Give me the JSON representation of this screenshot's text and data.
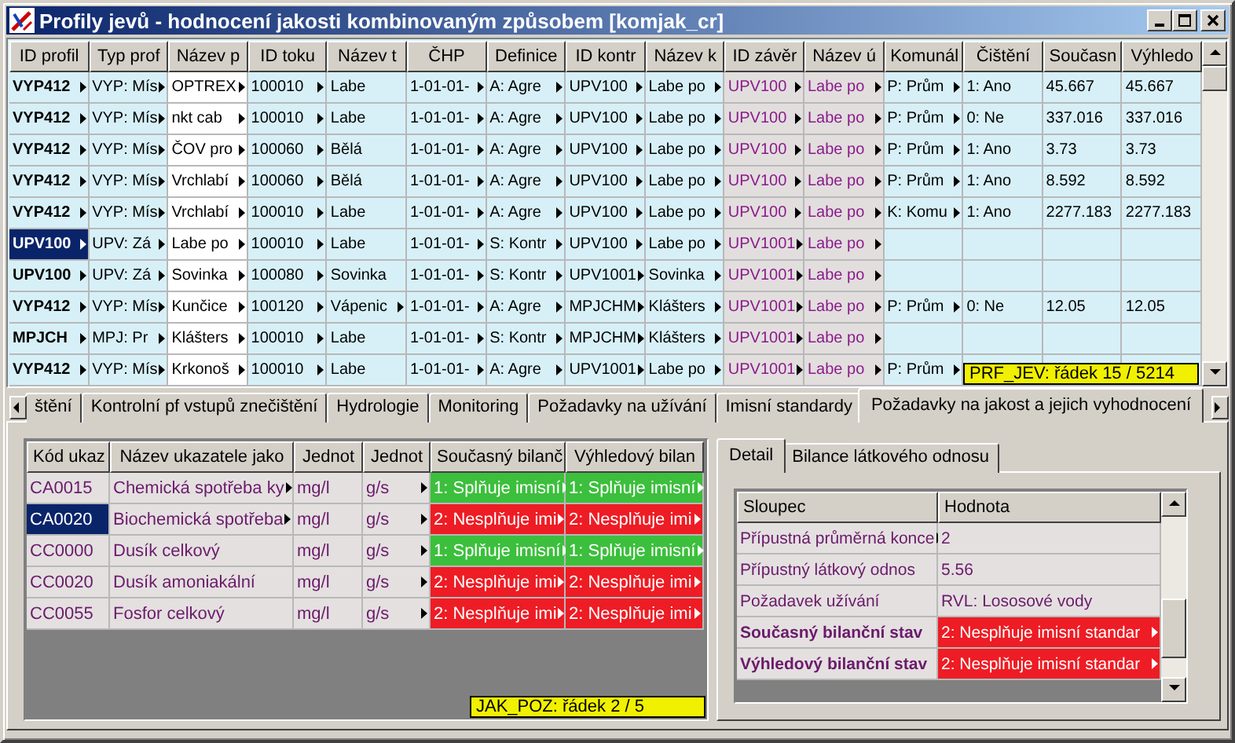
{
  "window": {
    "title": "Profily jevů - hodnocení jakosti kombinovaným způsobem [komjak_cr]"
  },
  "table": {
    "columns": [
      {
        "label": "ID profil",
        "kind": "key"
      },
      {
        "label": "Typ prof",
        "kind": "text"
      },
      {
        "label": "Název p",
        "kind": "edit"
      },
      {
        "label": "ID toku",
        "kind": "text"
      },
      {
        "label": "Název t",
        "kind": "text"
      },
      {
        "label": "ČHP",
        "kind": "text"
      },
      {
        "label": "Definice",
        "kind": "text"
      },
      {
        "label": "ID kontr",
        "kind": "text"
      },
      {
        "label": "Název k",
        "kind": "text"
      },
      {
        "label": "ID závěr",
        "kind": "ref"
      },
      {
        "label": "Název ú",
        "kind": "ref"
      },
      {
        "label": "Komunál",
        "kind": "text"
      },
      {
        "label": "Čištění",
        "kind": "text"
      },
      {
        "label": "Současn",
        "kind": "text"
      },
      {
        "label": "Výhledo",
        "kind": "text"
      }
    ],
    "rows": [
      {
        "selected": false,
        "cells": [
          "VYP412",
          "VYP: Mís",
          "OPTREX",
          "100010",
          "Labe",
          "1-01-01-",
          "A: Agre",
          "UPV100",
          "Labe po",
          "UPV100",
          "Labe po",
          "P: Prům",
          "1: Ano",
          "45.667",
          "45.667"
        ],
        "more": [
          true,
          true,
          true,
          true,
          false,
          true,
          true,
          true,
          true,
          true,
          true,
          true,
          false,
          false,
          false
        ]
      },
      {
        "selected": false,
        "cells": [
          "VYP412",
          "VYP: Mís",
          "nkt cab",
          "100010",
          "Labe",
          "1-01-01-",
          "A: Agre",
          "UPV100",
          "Labe po",
          "UPV100",
          "Labe po",
          "P: Prům",
          "0: Ne",
          "337.016",
          "337.016"
        ],
        "more": [
          true,
          true,
          true,
          true,
          false,
          true,
          true,
          true,
          true,
          true,
          true,
          true,
          false,
          false,
          false
        ]
      },
      {
        "selected": false,
        "cells": [
          "VYP412",
          "VYP: Mís",
          "ČOV pro",
          "100060",
          "Bělá",
          "1-01-01-",
          "A: Agre",
          "UPV100",
          "Labe po",
          "UPV100",
          "Labe po",
          "P: Prům",
          "1: Ano",
          "3.73",
          "3.73"
        ],
        "more": [
          true,
          true,
          true,
          true,
          false,
          true,
          true,
          true,
          true,
          true,
          true,
          true,
          false,
          false,
          false
        ]
      },
      {
        "selected": false,
        "cells": [
          "VYP412",
          "VYP: Mís",
          "Vrchlabí",
          "100060",
          "Bělá",
          "1-01-01-",
          "A: Agre",
          "UPV100",
          "Labe po",
          "UPV100",
          "Labe po",
          "P: Prům",
          "1: Ano",
          "8.592",
          "8.592"
        ],
        "more": [
          true,
          true,
          true,
          true,
          false,
          true,
          true,
          true,
          true,
          true,
          true,
          true,
          false,
          false,
          false
        ]
      },
      {
        "selected": false,
        "cells": [
          "VYP412",
          "VYP: Mís",
          "Vrchlabí",
          "100010",
          "Labe",
          "1-01-01-",
          "A: Agre",
          "UPV100",
          "Labe po",
          "UPV100",
          "Labe po",
          "K: Komu",
          "1: Ano",
          "2277.183",
          "2277.183"
        ],
        "more": [
          true,
          true,
          true,
          true,
          false,
          true,
          true,
          true,
          true,
          true,
          true,
          true,
          false,
          false,
          false
        ]
      },
      {
        "selected": true,
        "cells": [
          "UPV100",
          "UPV: Zá",
          "Labe po",
          "100010",
          "Labe",
          "1-01-01-",
          "S: Kontr",
          "UPV100",
          "Labe po",
          "UPV1001",
          "Labe po"
        ],
        "more": [
          true,
          true,
          true,
          true,
          false,
          true,
          true,
          true,
          true,
          true,
          true
        ]
      },
      {
        "selected": false,
        "cells": [
          "UPV100",
          "UPV: Zá",
          "Sovinka",
          "100080",
          "Sovinka",
          "1-01-01-",
          "S: Kontr",
          "UPV1001",
          "Sovinka",
          "UPV1001",
          "Labe po"
        ],
        "more": [
          true,
          true,
          true,
          true,
          false,
          true,
          true,
          true,
          true,
          true,
          true
        ]
      },
      {
        "selected": false,
        "cells": [
          "VYP412",
          "VYP: Mís",
          "Kunčice",
          "100120",
          "Vápenic",
          "1-01-01-",
          "A: Agre",
          "MPJCHM",
          "Klášters",
          "UPV1001",
          "Labe po",
          "P: Prům",
          "0: Ne",
          "12.05",
          "12.05"
        ],
        "more": [
          true,
          true,
          true,
          true,
          true,
          true,
          true,
          true,
          true,
          true,
          true,
          true,
          false,
          false,
          false
        ]
      },
      {
        "selected": false,
        "cells": [
          "MPJCH",
          "MPJ: Pr",
          "Klášters",
          "100010",
          "Labe",
          "1-01-01-",
          "S: Kontr",
          "MPJCHM",
          "Klášters",
          "UPV1001",
          "Labe po"
        ],
        "more": [
          true,
          true,
          true,
          true,
          false,
          true,
          true,
          true,
          true,
          true,
          true
        ]
      },
      {
        "selected": false,
        "cells": [
          "VYP412",
          "VYP: Mís",
          "Krkonoš",
          "100010",
          "Labe",
          "1-01-01-",
          "A: Agre",
          "UPV1001",
          "Labe po",
          "UPV1001",
          "Labe po",
          "P: Prům"
        ],
        "more": [
          true,
          true,
          true,
          true,
          false,
          true,
          true,
          true,
          true,
          true,
          true,
          true
        ]
      }
    ],
    "status": "PRF_JEV: řádek 15 / 5214"
  },
  "tabs": [
    {
      "label": "štění",
      "selected": false
    },
    {
      "label": "Kontrolní pf vstupů znečištění",
      "selected": false
    },
    {
      "label": "Hydrologie",
      "selected": false
    },
    {
      "label": "Monitoring",
      "selected": false
    },
    {
      "label": "Požadavky na užívání",
      "selected": false
    },
    {
      "label": "Imisní standardy",
      "selected": false
    },
    {
      "label": "Požadavky na jakost a jejich vyhodnocení",
      "selected": true
    }
  ],
  "indicators": {
    "columns": [
      "Kód ukaz",
      "Název ukazatele jako",
      "Jednot",
      "Jednot",
      "Současný bilanč",
      "Výhledový bilan"
    ],
    "rows": [
      {
        "selected": false,
        "cells": [
          {
            "text": "CA0015",
            "more": false
          },
          {
            "text": "Chemická spotřeba ky",
            "more": true
          },
          {
            "text": "mg/l",
            "more": false
          },
          {
            "text": "g/s",
            "more": true
          },
          {
            "text": "1: Splňuje imisní",
            "more": true,
            "color": "#3cbf3c"
          },
          {
            "text": "1: Splňuje imisní",
            "more": true,
            "color": "#3cbf3c"
          }
        ]
      },
      {
        "selected": true,
        "cells": [
          {
            "text": "CA0020",
            "more": false
          },
          {
            "text": "Biochemická spotřeba",
            "more": true
          },
          {
            "text": "mg/l",
            "more": false
          },
          {
            "text": "g/s",
            "more": true
          },
          {
            "text": "2: Nesplňuje imi",
            "more": true,
            "color": "#ee1c24"
          },
          {
            "text": "2: Nesplňuje imi",
            "more": true,
            "color": "#ee1c24"
          }
        ]
      },
      {
        "selected": false,
        "cells": [
          {
            "text": "CC0000",
            "more": false
          },
          {
            "text": "Dusík celkový",
            "more": false
          },
          {
            "text": "mg/l",
            "more": false
          },
          {
            "text": "g/s",
            "more": true
          },
          {
            "text": "1: Splňuje imisní",
            "more": true,
            "color": "#3cbf3c"
          },
          {
            "text": "1: Splňuje imisní",
            "more": true,
            "color": "#3cbf3c"
          }
        ]
      },
      {
        "selected": false,
        "cells": [
          {
            "text": "CC0020",
            "more": false
          },
          {
            "text": "Dusík amoniakální",
            "more": false
          },
          {
            "text": "mg/l",
            "more": false
          },
          {
            "text": "g/s",
            "more": true
          },
          {
            "text": "2: Nesplňuje imi",
            "more": true,
            "color": "#ee1c24"
          },
          {
            "text": "2: Nesplňuje imi",
            "more": true,
            "color": "#ee1c24"
          }
        ]
      },
      {
        "selected": false,
        "cells": [
          {
            "text": "CC0055",
            "more": false
          },
          {
            "text": "Fosfor celkový",
            "more": false
          },
          {
            "text": "mg/l",
            "more": false
          },
          {
            "text": "g/s",
            "more": true
          },
          {
            "text": "2: Nesplňuje imi",
            "more": true,
            "color": "#ee1c24"
          },
          {
            "text": "2: Nesplňuje imi",
            "more": true,
            "color": "#ee1c24"
          }
        ]
      }
    ],
    "status": "JAK_POZ: řádek 2 / 5"
  },
  "detail_tabs": [
    {
      "label": "Detail",
      "selected": true
    },
    {
      "label": "Bilance látkového odnosu",
      "selected": false
    }
  ],
  "detail": {
    "columns": [
      "Sloupec",
      "Hodnota"
    ],
    "rows": [
      {
        "label": "Přípustná průměrná konce",
        "value": "2",
        "emphasized": false,
        "more": true
      },
      {
        "label": "Přípustný látkový odnos",
        "value": "5.56",
        "emphasized": false,
        "more": false
      },
      {
        "label": "Požadavek užívání",
        "value": "RVL: Lososové vody",
        "emphasized": false,
        "more": false
      },
      {
        "label": "Současný bilanční stav",
        "value": "2: Nesplňuje imisní standar",
        "emphasized": true,
        "more": false,
        "color": "#ee1c24"
      },
      {
        "label": "Výhledový bilanční stav",
        "value": "2: Nesplňuje imisní standar",
        "emphasized": true,
        "more": false,
        "color": "#ee1c24"
      }
    ]
  }
}
